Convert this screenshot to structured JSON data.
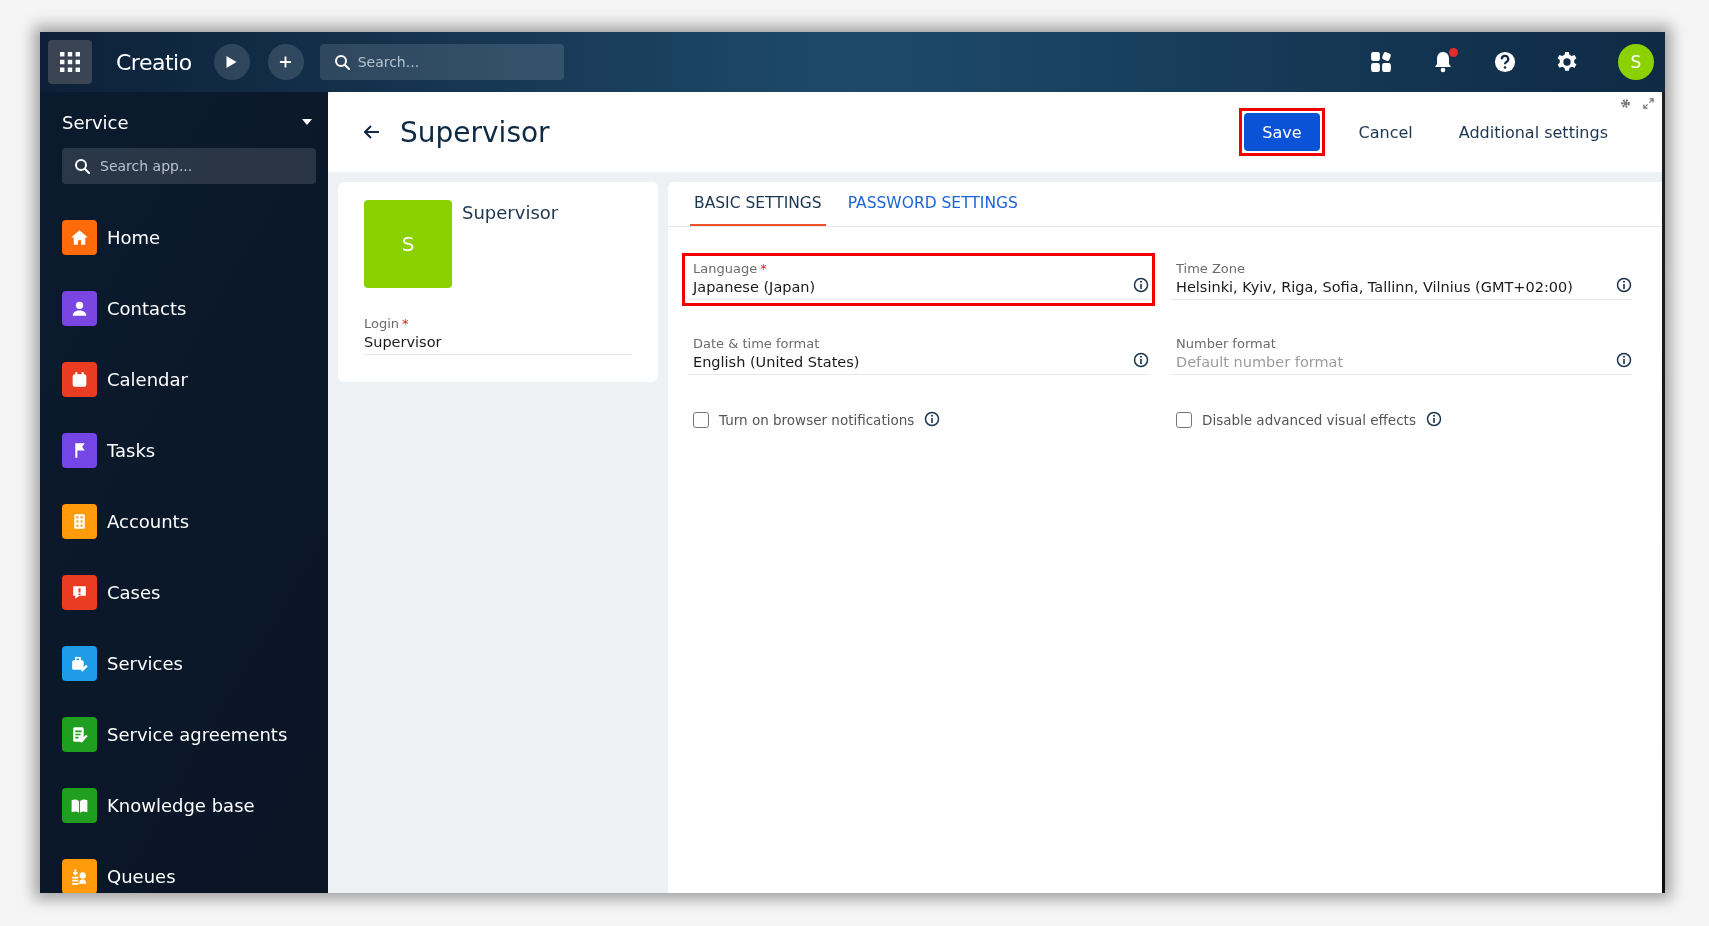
{
  "topbar": {
    "logo": "Creatio",
    "search": {
      "placeholder": "Search..."
    },
    "notifications_unread": true,
    "avatar": "S"
  },
  "sidebar": {
    "workplace": "Service",
    "search": {
      "placeholder": "Search app..."
    },
    "items": [
      {
        "label": "Home",
        "kind": "home",
        "color": "#ff6b0a"
      },
      {
        "label": "Contacts",
        "kind": "person",
        "color": "#7a45e0"
      },
      {
        "label": "Calendar",
        "kind": "calendar",
        "color": "#ea3c22"
      },
      {
        "label": "Tasks",
        "kind": "flag",
        "color": "#7446e6"
      },
      {
        "label": "Accounts",
        "kind": "building",
        "color": "#ff9a0a"
      },
      {
        "label": "Cases",
        "kind": "alert",
        "color": "#ea3c22"
      },
      {
        "label": "Services",
        "kind": "toolbox",
        "color": "#1e9ce8"
      },
      {
        "label": "Service agreements",
        "kind": "document",
        "color": "#1f9e1f"
      },
      {
        "label": "Knowledge base",
        "kind": "book",
        "color": "#1f9e1f"
      },
      {
        "label": "Queues",
        "kind": "queue",
        "color": "#ff9a0a"
      }
    ]
  },
  "page": {
    "title": "Supervisor",
    "buttons": [
      {
        "label": "Save",
        "kind": "primary",
        "highlighted": true
      },
      {
        "label": "Cancel",
        "kind": "flat",
        "highlighted": false
      },
      {
        "label": "Additional settings",
        "kind": "flat",
        "highlighted": false
      }
    ]
  },
  "profile": {
    "avatar": "S",
    "name": "Supervisor",
    "login": {
      "label": "Login",
      "required_mark": "*",
      "value": "Supervisor"
    }
  },
  "tabs": [
    {
      "label": "BASIC SETTINGS",
      "selected": true
    },
    {
      "label": "PASSWORD SETTINGS",
      "selected": false
    }
  ],
  "fields": [
    {
      "label": "Language",
      "required_mark": "*",
      "value": "Japanese (Japan)",
      "highlighted": true
    },
    {
      "label": "Time Zone",
      "value": "Helsinki, Kyiv, Riga, Sofia, Tallinn, Vilnius (GMT+02:00)",
      "highlighted": false
    },
    {
      "label": "Date & time format",
      "value": "English (United States)",
      "highlighted": false
    },
    {
      "label": "Number format",
      "placeholder": "Default number format",
      "highlighted": false
    }
  ],
  "checkboxes": [
    {
      "label": "Turn on browser notifications",
      "checked": false
    },
    {
      "label": "Disable advanced visual effects",
      "checked": false
    }
  ]
}
